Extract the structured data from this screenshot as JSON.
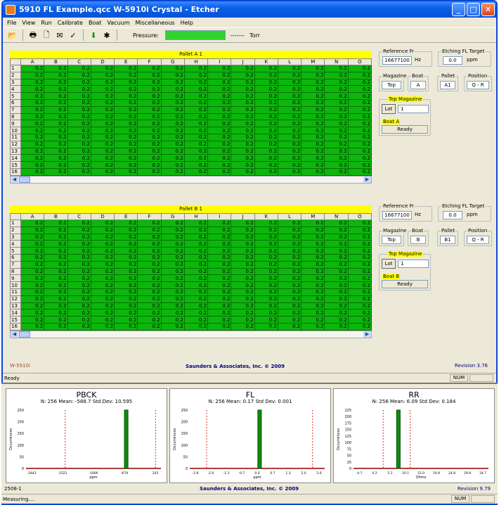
{
  "window": {
    "title": "5910 FL Example.qcc W-5910i Crystal - Etcher"
  },
  "menu": [
    "File",
    "View",
    "Run",
    "Calibrate",
    "Boat",
    "Vacuum",
    "Miscellaneous",
    "Help"
  ],
  "toolbar": {
    "pressure_label": "Pressure:",
    "pressure_value": "-------",
    "pressure_unit": "Torr"
  },
  "columns": [
    "A",
    "B",
    "C",
    "D",
    "E",
    "F",
    "G",
    "H",
    "I",
    "J",
    "K",
    "L",
    "M",
    "N",
    "O"
  ],
  "rows": [
    "1",
    "2",
    "3",
    "4",
    "5",
    "6",
    "7",
    "8",
    "9",
    "10",
    "11",
    "12",
    "13",
    "14",
    "15",
    "16"
  ],
  "cell_value": "0.2",
  "pallets": [
    {
      "title": "Pallet A 1",
      "ref_label": "Reference Fr",
      "ref_value": "16677100",
      "ref_unit": "Hz",
      "target_label": "Etching FL Target",
      "target_value": "0.0",
      "target_unit": "ppm",
      "magazine_label": "Magazine",
      "magazine": "Top",
      "boat_label": "Boat",
      "boat": "A",
      "pallet_label": "Pallet",
      "pallet": "A1",
      "position_label": "Position",
      "position": "Q - R",
      "top_magazine": "Top Magazine",
      "lot_button": "Lot",
      "lot_value": "1",
      "boat_status_label": "Boat A",
      "boat_status": "Ready"
    },
    {
      "title": "Pallet B 1",
      "ref_label": "Reference Fr",
      "ref_value": "16677100",
      "ref_unit": "Hz",
      "target_label": "Etching FL Target",
      "target_value": "0.0",
      "target_unit": "ppm",
      "magazine_label": "Magazine",
      "magazine": "Top",
      "boat_label": "Boat",
      "boat": "B",
      "pallet_label": "Pallet",
      "pallet": "B1",
      "position_label": "Position",
      "position": "Q - R",
      "top_magazine": "Top Magazine",
      "lot_button": "Lot",
      "lot_value": "1",
      "boat_status_label": "Boat B",
      "boat_status": "Ready"
    }
  ],
  "footer": {
    "model": "W-5910i",
    "company": "Saunders & Associates, Inc. © 2009",
    "revision": "Revision 3.76"
  },
  "status": {
    "text": "Ready",
    "num": "NUM"
  },
  "charts": [
    {
      "title": "PBCK",
      "stats": "N: 256  Mean: -588.7  Std Dev: 10.595",
      "xlabel": "ppm",
      "ylabel": "Occurrences",
      "yticks": [
        "250",
        "200",
        "150",
        "100",
        "50",
        "0"
      ],
      "xticks": [
        "-3443",
        "-2521",
        "-1600",
        "-679",
        "243"
      ]
    },
    {
      "title": "FL",
      "stats": "N: 256  Mean: 0.17  Std Dev: 0.001",
      "xlabel": "ppm",
      "ylabel": "Occurrences",
      "yticks": [
        "250",
        "200",
        "150",
        "100",
        "50",
        "0"
      ],
      "xticks": [
        "-2.8",
        "-2.0",
        "-1.3",
        "-0.7",
        "0.0",
        "0.7",
        "1.3",
        "2.0",
        "2.6"
      ]
    },
    {
      "title": "RR",
      "stats": "N: 256  Mean: 6.09  Std Dev: 0.184",
      "xlabel": "Ohms",
      "ylabel": "Occurrences",
      "yticks": [
        "225",
        "200",
        "175",
        "150",
        "125",
        "100",
        "75",
        "50",
        "25",
        "0"
      ],
      "xticks": [
        "-4.7",
        "0.2",
        "5.1",
        "10.1",
        "15.0",
        "19.9",
        "24.8",
        "29.8",
        "34.7"
      ]
    }
  ],
  "bottom_footer": {
    "model": "2508-1",
    "company": "Saunders & Associates, Inc. © 2009",
    "revision": "Revision 9.79"
  },
  "bottom_status": {
    "text": "Measuring....",
    "num": "NUM"
  }
}
